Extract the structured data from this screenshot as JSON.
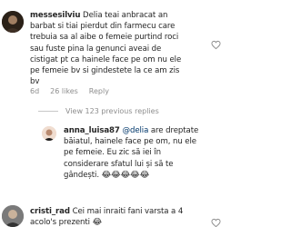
{
  "comments": [
    {
      "username": "messesilviu",
      "lines": [
        " Delia teai anbracat an",
        "barbat si tiai pierdut din farmecu care",
        "trebuia sa al aibe o femeie purtind roci",
        "sau fuste pina la genunci aveai de",
        "cistigat pt ca hainele face pe om nu ele",
        "pe femeie bv si gindestete la ce am zis",
        "bv"
      ],
      "meta": {
        "age": "6d",
        "likes": "26 likes",
        "reply": "Reply"
      }
    }
  ],
  "view_replies": "View 123 previous replies",
  "reply": {
    "username": "anna_luisa87",
    "mention": "@delia",
    "lines": [
      " are dreptate",
      "băiatul, hainele face pe om, nu ele",
      "pe femeie. Eu zic să iei în",
      "considerare sfatul lui și să te",
      "gândești."
    ],
    "emojis": "😂😂😂😂😂"
  },
  "last_comment": {
    "username": "cristi_rad",
    "lines": [
      " Cei mai inraiti fani varsta a 4",
      "acolo's prezenti "
    ],
    "emoji": "😂"
  },
  "icons": {
    "heart": "heart-icon"
  },
  "colors": {
    "text": "#262626",
    "meta": "#8e8e8e",
    "mention": "#00376b"
  }
}
